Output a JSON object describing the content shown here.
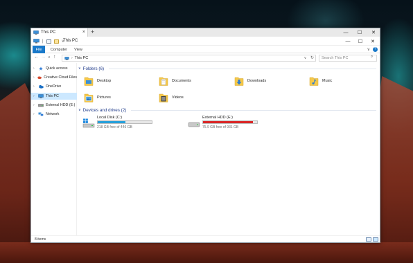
{
  "window": {
    "tab_title": "This PC",
    "new_tab": "+",
    "tab_close": "×",
    "title": "This PC",
    "controls": {
      "minimize": "—",
      "maximize": "☐",
      "close": "✕"
    }
  },
  "ribbon": {
    "tabs": [
      "File",
      "Computer",
      "View"
    ],
    "expand": "∨",
    "help": "?"
  },
  "address": {
    "back": "←",
    "forward": "→",
    "recent": "∨",
    "up": "↑",
    "separator": "›",
    "path": "This PC",
    "dropdown": "∨",
    "refresh": "↻",
    "search_placeholder": "Search This PC",
    "search_icon": "⌕"
  },
  "nav": {
    "items": [
      {
        "label": "Quick access",
        "icon": "star-icon",
        "color": "#2f7bd6",
        "selected": false
      },
      {
        "label": "Creative Cloud Files",
        "icon": "creative-cloud-icon",
        "color": "#d64a2f",
        "selected": false
      },
      {
        "label": "OneDrive",
        "icon": "onedrive-icon",
        "color": "#1a6fc4",
        "selected": false
      },
      {
        "label": "This PC",
        "icon": "computer-icon",
        "color": "#3b8fd6",
        "selected": true
      },
      {
        "label": "External HDD (E:)",
        "icon": "drive-icon",
        "color": "#6b6b6b",
        "selected": false
      },
      {
        "label": "Network",
        "icon": "network-icon",
        "color": "#3b8fd6",
        "selected": false
      }
    ],
    "arrow": "›"
  },
  "folders": {
    "header": "Folders (6)",
    "chevron": "∨",
    "items": [
      {
        "label": "Desktop",
        "icon": "desktop-folder-icon",
        "badge": "#3b8fd6"
      },
      {
        "label": "Documents",
        "icon": "documents-folder-icon",
        "badge": "#ffffff"
      },
      {
        "label": "Downloads",
        "icon": "downloads-folder-icon",
        "badge": "#2e7dd1"
      },
      {
        "label": "Music",
        "icon": "music-folder-icon",
        "badge": "#2e7dd1"
      },
      {
        "label": "Pictures",
        "icon": "pictures-folder-icon",
        "badge": "#4aa0e0"
      },
      {
        "label": "Videos",
        "icon": "videos-folder-icon",
        "badge": "#404040"
      }
    ]
  },
  "drives": {
    "header": "Devices and drives (2)",
    "chevron": "∨",
    "items": [
      {
        "name": "Local Disk (C:)",
        "free": "218 GB free of 446 GB",
        "used_fraction": 0.51,
        "bar_color": "#26a0da",
        "icon": "windows-drive-icon"
      },
      {
        "name": "External HDD (E:)",
        "free": "75.9 GB free of 931 GB",
        "used_fraction": 0.92,
        "bar_color": "#da2626",
        "icon": "external-drive-icon"
      }
    ]
  },
  "status": {
    "items": "8 items"
  },
  "colors": {
    "accent": "#1979ca",
    "selection": "#cce8ff",
    "group_header": "#1e3a8a",
    "folder_yellow": "#f6c94a"
  }
}
